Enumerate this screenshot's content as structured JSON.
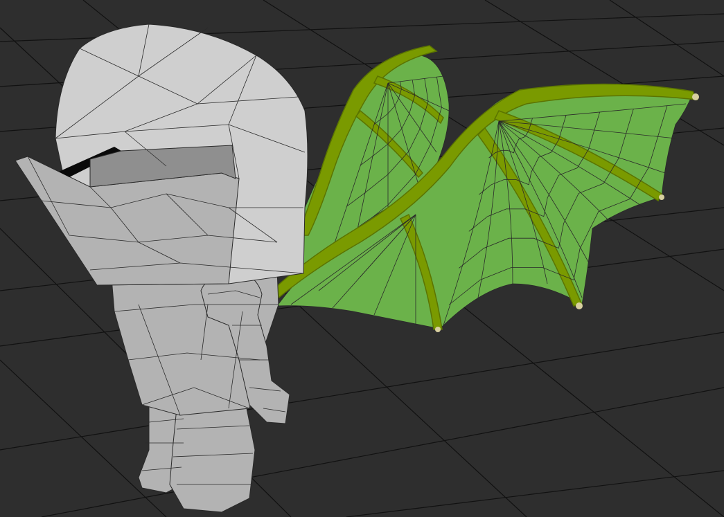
{
  "viewport": {
    "background": "#2e2e2e",
    "grid_color": "#111111",
    "mesh_wire_color": "#2a2a2a",
    "body_shade_light": "#cfcfcf",
    "body_shade_mid": "#b3b3b3",
    "body_shade_dark": "#8f8f8f",
    "wing_membrane_color": "#6bb24a",
    "wing_membrane_dark": "#4f8f35",
    "wing_bone_color": "#7a9a00",
    "wing_bone_dark": "#5b7400",
    "wireframe_on": true,
    "grid_on": true
  },
  "scene": {
    "objects": [
      {
        "name": "armored-knight-mesh",
        "material": "grey"
      },
      {
        "name": "dragon-wing-left-mesh",
        "material": "green"
      },
      {
        "name": "dragon-wing-right-mesh",
        "material": "green"
      }
    ]
  }
}
